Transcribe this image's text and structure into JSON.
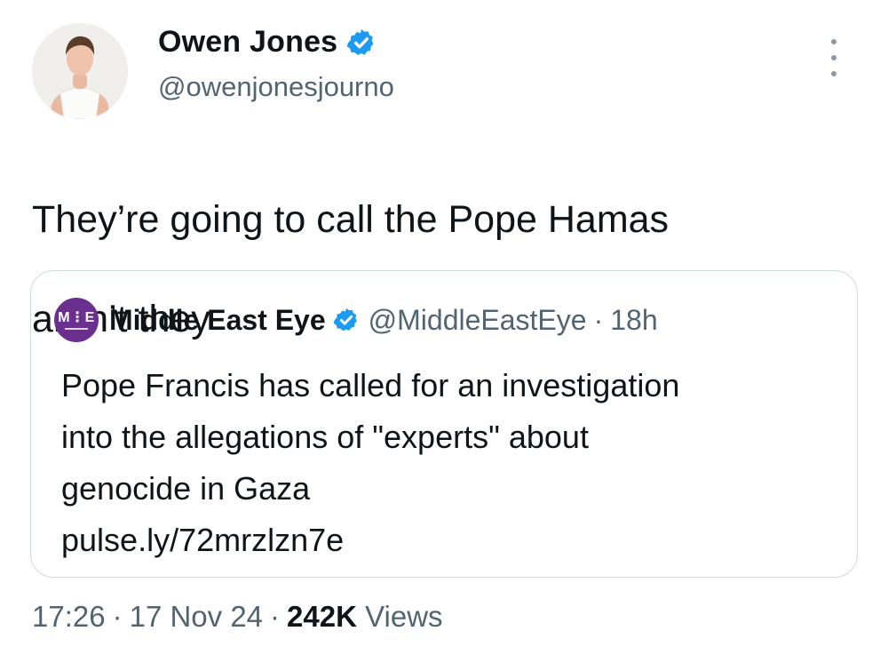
{
  "author": {
    "name": "Owen Jones",
    "handle": "@owenjonesjourno",
    "verified": true
  },
  "tweet": {
    "text_line1": "They’re going to call the Pope Hamas",
    "text_line2": "aren’t they"
  },
  "quote": {
    "logo_text": "M⋮E",
    "name": "Middle East Eye",
    "handle": "@MiddleEastEye",
    "separator": "·",
    "time": "18h",
    "text_line1": "Pope Francis has called for an investigation",
    "text_line2": "into the allegations of \"experts\" about",
    "text_line3": "genocide in Gaza",
    "link": "pulse.ly/72mrzlzn7e"
  },
  "meta": {
    "time": "17:26",
    "separator": "·",
    "date": "17 Nov 24",
    "views_count": "242K",
    "views_label": "Views"
  },
  "colors": {
    "verified_blue": "#1d9bf0",
    "secondary_text": "#536471",
    "primary_text": "#0f1419",
    "mee_purple": "#6a2f8f",
    "border": "#cfd9de"
  }
}
